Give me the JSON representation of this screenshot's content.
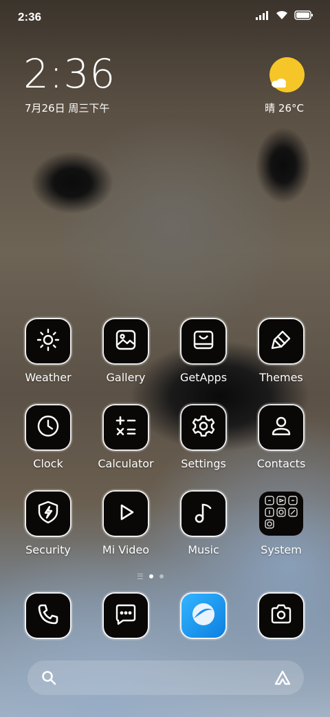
{
  "status_bar": {
    "time": "2:36",
    "icons": [
      "cellular-signal-icon",
      "wifi-icon",
      "battery-icon"
    ]
  },
  "clock": {
    "time": "2:36",
    "date": "7月26日 周三下午"
  },
  "weather": {
    "text": "晴 26°C",
    "icon": "sunny-partly-cloudy-icon",
    "sun_color": "#f6c628"
  },
  "apps": [
    {
      "label": "Weather",
      "icon": "sun-icon"
    },
    {
      "label": "Gallery",
      "icon": "image-icon"
    },
    {
      "label": "GetApps",
      "icon": "store-icon"
    },
    {
      "label": "Themes",
      "icon": "paintbrush-icon"
    },
    {
      "label": "Clock",
      "icon": "clock-icon"
    },
    {
      "label": "Calculator",
      "icon": "calculator-icon"
    },
    {
      "label": "Settings",
      "icon": "gear-icon"
    },
    {
      "label": "Contacts",
      "icon": "person-icon"
    },
    {
      "label": "Security",
      "icon": "shield-bolt-icon"
    },
    {
      "label": "Mi Video",
      "icon": "play-icon"
    },
    {
      "label": "Music",
      "icon": "music-note-icon"
    },
    {
      "label": "System",
      "icon": "folder-grid-icon"
    }
  ],
  "page_indicator": {
    "total": 2,
    "active": 1
  },
  "dock": [
    {
      "icon": "phone-icon"
    },
    {
      "icon": "message-icon"
    },
    {
      "icon": "browser-icon"
    },
    {
      "icon": "camera-icon"
    }
  ],
  "search": {
    "left_icon": "search-icon",
    "right_icon": "assistant-icon"
  }
}
